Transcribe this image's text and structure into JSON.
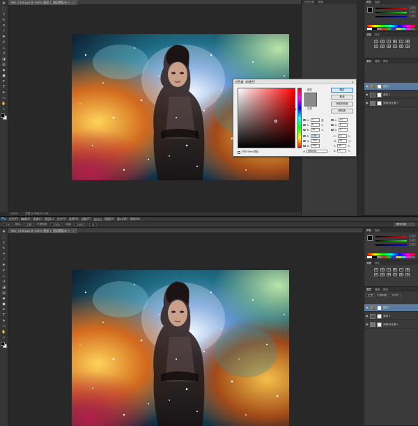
{
  "top_window": {
    "doc_tab": "IMG_7438.psd @ 100% (图层 1, 图层蒙版/8) *",
    "status": {
      "zoom": "100%",
      "doc_size": "文档:3.93M/13.5M"
    },
    "mid_panel_tabs": [
      "历史记录",
      "颜色"
    ],
    "color_panel_tabs": [
      "颜色",
      "色板"
    ],
    "color_values": [
      "128",
      "128",
      "128"
    ],
    "adjust_tabs": [
      "调整",
      "样式"
    ],
    "layers_tabs": [
      "图层",
      "通道",
      "路径"
    ],
    "layers": [
      {
        "name": "图层 1",
        "selected": true
      },
      {
        "name": "曲线 1",
        "selected": false
      },
      {
        "name": "亮度/对比度 1",
        "selected": false
      }
    ]
  },
  "color_picker": {
    "title": "拾色器（前景色）",
    "close": "×",
    "label_new": "新的",
    "label_current": "当前",
    "buttons": [
      "确定",
      "取消",
      "添加到色板",
      "颜色库"
    ],
    "hsb": [
      {
        "label": "H:",
        "value": "0",
        "unit": "度",
        "selected": true
      },
      {
        "label": "S:",
        "value": "0",
        "unit": "%",
        "selected": false
      },
      {
        "label": "B:",
        "value": "50",
        "unit": "%",
        "selected": false
      }
    ],
    "rgb": [
      {
        "label": "R:",
        "value": "128"
      },
      {
        "label": "G:",
        "value": "128"
      },
      {
        "label": "B:",
        "value": "128"
      }
    ],
    "lab": [
      {
        "label": "L:",
        "value": "54"
      },
      {
        "label": "a:",
        "value": "0"
      },
      {
        "label": "b:",
        "value": "0"
      }
    ],
    "cmyk": [
      {
        "label": "C:",
        "value": "52",
        "unit": "%"
      },
      {
        "label": "M:",
        "value": "43",
        "unit": "%"
      },
      {
        "label": "Y:",
        "value": "40",
        "unit": "%"
      },
      {
        "label": "K:",
        "value": "0",
        "unit": "%"
      }
    ],
    "web_only_label": "只有 Web 颜色",
    "hex_label": "#",
    "hex_value": "808080"
  },
  "bottom_window": {
    "ps_logo": "Ps",
    "menu": [
      "文件(F)",
      "编辑(E)",
      "图像(I)",
      "图层(L)",
      "文字(Y)",
      "选择(S)",
      "滤镜(T)",
      "3D(D)",
      "视图(V)",
      "窗口(W)",
      "帮助(H)"
    ],
    "options": {
      "mode_label": "模式:",
      "mode_value": "正常",
      "opacity_label": "不透明度:",
      "opacity_value": "100%",
      "flow_label": "流量:",
      "flow_value": "100%"
    },
    "workspace": "基本功能",
    "doc_tab": "IMG_7438.psd @ 100% (图层 1, 图层蒙版/8) *",
    "color_values": [
      "128",
      "128",
      "128"
    ],
    "layers_tabs": [
      "图层",
      "通道",
      "路径"
    ],
    "blend_mode": "正常",
    "opacity_label": "不透明度:",
    "opacity_value": "100%",
    "layers": [
      {
        "name": "图层 1",
        "selected": true
      },
      {
        "name": "曲线 1",
        "selected": false
      },
      {
        "name": "亮度/对比度 1",
        "selected": false
      }
    ]
  },
  "icons": {
    "tools": [
      "move-icon",
      "marquee-icon",
      "lasso-icon",
      "quick-select-icon",
      "crop-icon",
      "eyedropper-icon",
      "healing-icon",
      "brush-icon",
      "clone-stamp-icon",
      "history-brush-icon",
      "eraser-icon",
      "gradient-icon",
      "blur-icon",
      "dodge-icon",
      "pen-icon",
      "type-icon",
      "path-select-icon",
      "shape-icon",
      "hand-icon",
      "zoom-icon"
    ]
  },
  "colors": {
    "foreground": "#000000",
    "background": "#ffffff",
    "picked": "#808080"
  }
}
